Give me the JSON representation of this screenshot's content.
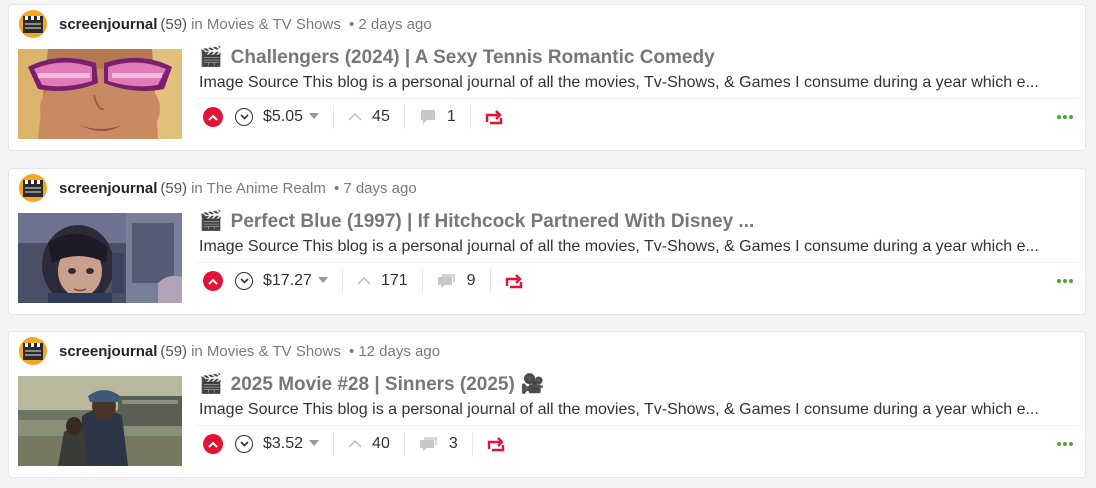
{
  "colors": {
    "accent": "#e31337",
    "more_dots": "#4aaa2e",
    "avatar_bg": "#f5a623"
  },
  "posts": [
    {
      "author": "screenjournal",
      "reputation": "(59)",
      "in_label": "in",
      "community": "Movies & TV Shows",
      "bullet": "•",
      "time": "2 days ago",
      "title_icon": "🎬",
      "title": "Challengers (2024) | A Sexy Tennis Romantic Comedy",
      "summary": "Image Source This blog is a personal journal of all the movies, Tv-Shows, & Games I consume during a year which e...",
      "payout": "$5.05",
      "votes": "45",
      "comments": "1",
      "thumbnail": "challengers-poster"
    },
    {
      "author": "screenjournal",
      "reputation": "(59)",
      "in_label": "in",
      "community": "The Anime Realm",
      "bullet": "•",
      "time": "7 days ago",
      "title_icon": "🎬",
      "title": "Perfect Blue (1997) | If Hitchcock Partnered With Disney ...",
      "summary": "Image Source This blog is a personal journal of all the movies, Tv-Shows, & Games I consume during a year which e...",
      "payout": "$17.27",
      "votes": "171",
      "comments": "9",
      "thumbnail": "perfect-blue-still"
    },
    {
      "author": "screenjournal",
      "reputation": "(59)",
      "in_label": "in",
      "community": "Movies & TV Shows",
      "bullet": "•",
      "time": "12 days ago",
      "title_icon": "🎬",
      "title": "2025 Movie #28 | Sinners (2025)",
      "title_suffix_icon": "🎥",
      "summary": "Image Source This blog is a personal journal of all the movies, Tv-Shows, & Games I consume during a year which e...",
      "payout": "$3.52",
      "votes": "40",
      "comments": "3",
      "thumbnail": "sinners-still"
    }
  ]
}
